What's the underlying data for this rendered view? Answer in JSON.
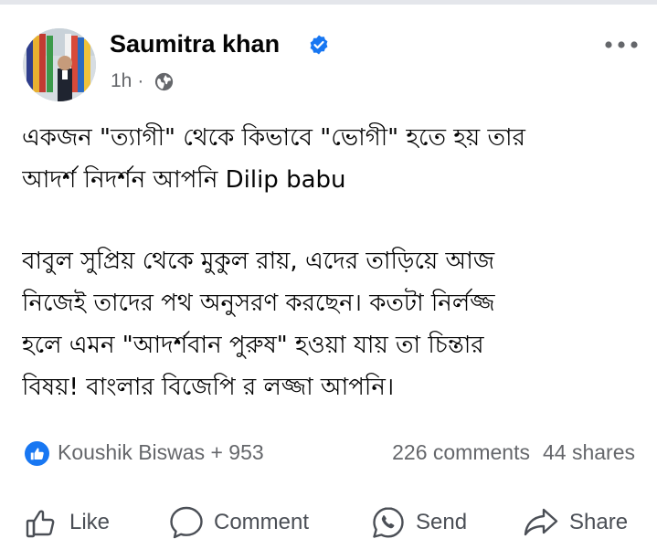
{
  "post": {
    "author": "Saumitra khan",
    "time": "1h",
    "separator": "·",
    "icons": {
      "verified": "verified-badge-icon",
      "audience": "globe-icon",
      "more": "more-options-icon"
    },
    "paragraphs": [
      {
        "lines": [
          "একজন \"ত্যাগী\" থেকে কিভাবে \"ভোগী\" হতে হয় তার",
          "আদর্শ নিদর্শন আপনি Dilip babu"
        ]
      },
      {
        "lines": [
          "বাবুল সুপ্রিয় থেকে মুকুল রায়, এদের তাড়িয়ে আজ",
          "নিজেই তাদের পথ অনুসরণ করছেন। কতটা নির্লজ্জ",
          "হলে এমন \"আদর্শবান পুরুষ\" হওয়া যায় তা চিন্তার",
          "বিষয়!  বাংলার বিজেপি র লজ্জা আপনি।"
        ]
      }
    ]
  },
  "reactions": {
    "icon": "like-reaction-icon",
    "summary": "Koushik Biswas + 953",
    "comments": "226 comments",
    "shares": "44 shares"
  },
  "actions": {
    "like": "Like",
    "comment": "Comment",
    "send": "Send",
    "share": "Share"
  },
  "colors": {
    "brand_blue": "#1877f2",
    "secondary_text": "#65676b",
    "primary_text": "#050505",
    "action_text": "#4b4f56"
  }
}
